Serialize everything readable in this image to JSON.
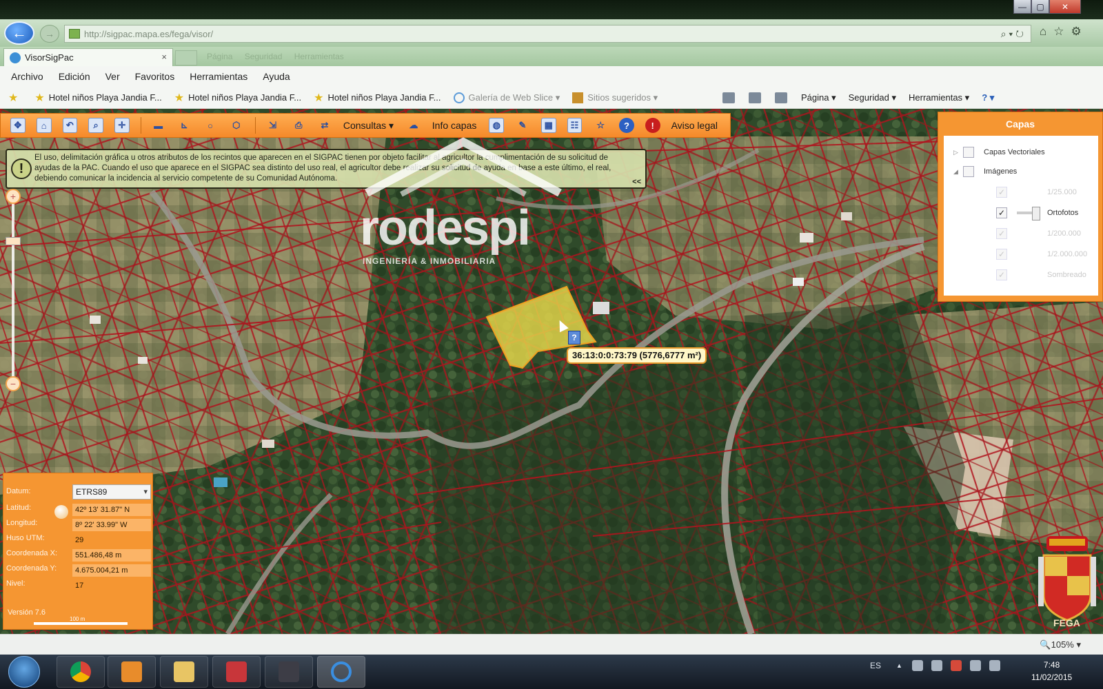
{
  "browser": {
    "url": "http://sigpac.mapa.es/fega/visor/",
    "tab_title": "VisorSigPac",
    "tab_close": "×",
    "ghost_tabs": "Página Seguridad Herramientas",
    "back_glyph": "←",
    "forward_glyph": "→",
    "url_tools": "⌕ ▾ ↻",
    "right_icons": "⌂☆⚙",
    "win_min": "—",
    "win_max": "▢",
    "win_close": "✕"
  },
  "menu": [
    "Archivo",
    "Edición",
    "Ver",
    "Favoritos",
    "Herramientas",
    "Ayuda"
  ],
  "favorites": {
    "items": [
      "Hotel niños Playa Jandia F...",
      "Hotel niños Playa Jandia F...",
      "Hotel niños Playa Jandia F..."
    ],
    "web_slice": "Galería de Web Slice ▾",
    "suggested": "Sitios sugeridos ▾",
    "commands": [
      "Página ▾",
      "Seguridad ▾",
      "Herramientas ▾",
      "? ▾"
    ]
  },
  "map_toolbar": {
    "consultas": "Consultas ▾",
    "info_capas": "Info capas",
    "aviso_legal": "Aviso legal",
    "help_glyph": "?",
    "star_glyph": "☆"
  },
  "notice": {
    "icon": "!",
    "text": "El uso, delimitación gráfica u otros atributos de los recintos que aparecen en el SIGPAC tienen por objeto facilitar al agricultor la cumplimentación de su solicitud de ayudas de la PAC. Cuando el uso que aparece en el SIGPAC sea distinto del uso real, el agricultor debe realizar su solicitud de ayuda en base a este último, el real, debiendo comunicar la incidencia al servicio competente de su Comunidad Autónoma.",
    "collapse": "<<"
  },
  "watermark": {
    "name": "rodespi",
    "subtitle": "INGENIERÍA & INMOBILIARIA"
  },
  "zoom": {
    "plus": "+",
    "minus": "−",
    "handle_level": 0.2
  },
  "parcel": {
    "query_glyph": "?",
    "label": "36:13:0:0:73:79 (5776,6777 m²)"
  },
  "layers": {
    "title": "Capas",
    "vector_layers": "Capas Vectoriales",
    "images": "Imágenes",
    "scales": [
      {
        "label": "1/25.000",
        "checked": true,
        "enabled": false
      },
      {
        "label": "Ortofotos",
        "checked": true,
        "enabled": true
      },
      {
        "label": "1/200.000",
        "checked": true,
        "enabled": false
      },
      {
        "label": "1/2.000.000",
        "checked": true,
        "enabled": false
      },
      {
        "label": "Sombreado",
        "checked": true,
        "enabled": false
      }
    ],
    "check_glyph": "✓"
  },
  "coords": {
    "datum_label": "Datum:",
    "datum_value": "ETRS89",
    "lat_label": "Latitud:",
    "lat_value": "42º 13' 31.87\" N",
    "lon_label": "Longitud:",
    "lon_value": "8º 22' 33.99\" W",
    "huso_label": "Huso UTM:",
    "huso_value": "29",
    "x_label": "Coordenada X:",
    "x_value": "551.486,48 m",
    "y_label": "Coordenada Y:",
    "y_value": "4.675.004,21 m",
    "nivel_label": "Nivel:",
    "nivel_value": "17",
    "version": "Versión 7.6",
    "scale_label": "100 m"
  },
  "fega": "FEGA",
  "status": {
    "zoom": "🔍105% ▾"
  },
  "taskbar": {
    "lang": "ES",
    "tray_arrow": "▲",
    "time": "7:48",
    "date": "11/02/2015"
  },
  "colors": {
    "parcel_lines": "#b0141e",
    "selected_parcel": "#e7d84a",
    "orange_ui": "#f59632"
  }
}
